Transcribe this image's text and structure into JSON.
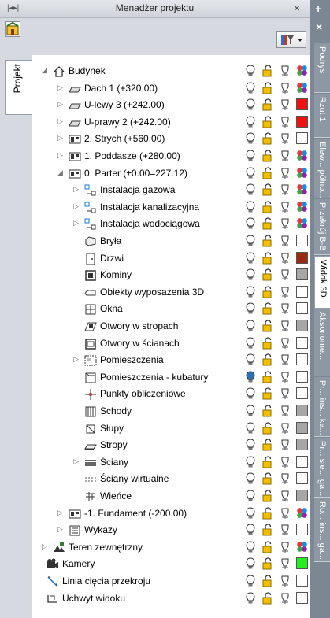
{
  "panel": {
    "title": "Menadżer projektu",
    "grip_icon": "grip-icon",
    "close_glyph": "×"
  },
  "left_tab": {
    "label": "Projekt"
  },
  "right_tabs": {
    "plus_glyph": "+",
    "close_glyph": "×",
    "items": [
      {
        "label": "Podrys"
      },
      {
        "label": "Rzut 1"
      },
      {
        "label": "Elew... półno..."
      },
      {
        "label": "Przekrój B-B"
      },
      {
        "label": "Widok 3D",
        "active": true
      },
      {
        "label": "Aksonome..."
      },
      {
        "label": "Pr... ins... ka..."
      },
      {
        "label": "Pr... sie... ga..."
      },
      {
        "label": "Ro... ins... ga..."
      }
    ]
  },
  "colors": {
    "red": "#ee1111",
    "dark_red": "#9b2a11",
    "gray": "#a6a6a6",
    "green": "#22ee22",
    "white": "#ffffff"
  },
  "tree": [
    {
      "label": "Budynek",
      "icon": "house-icon",
      "level": 0,
      "expander": "open",
      "color": "multi"
    },
    {
      "label": "Dach 1 (+320.00)",
      "icon": "roof-icon",
      "level": 1,
      "expander": "closed",
      "color": "multi"
    },
    {
      "label": "U-lewy 3 (+242.00)",
      "icon": "roof-icon",
      "level": 1,
      "expander": "closed",
      "color": "red"
    },
    {
      "label": "U-prawy 2 (+242.00)",
      "icon": "roof-icon",
      "level": 1,
      "expander": "closed",
      "color": "red"
    },
    {
      "label": "2. Strych (+560.00)",
      "icon": "storey-icon",
      "level": 1,
      "expander": "closed",
      "color": "white"
    },
    {
      "label": "1. Poddasze (+280.00)",
      "icon": "storey-icon",
      "level": 1,
      "expander": "closed",
      "color": "multi"
    },
    {
      "label": "0. Parter (±0.00=227.12)",
      "icon": "storey-icon",
      "level": 1,
      "expander": "open",
      "color": "multi"
    },
    {
      "label": "Instalacja gazowa",
      "icon": "installation-icon",
      "level": 2,
      "expander": "closed",
      "color": "multi"
    },
    {
      "label": "Instalacja kanalizacyjna",
      "icon": "installation-icon",
      "level": 2,
      "expander": "closed",
      "color": "multi"
    },
    {
      "label": "Instalacja wodociągowa",
      "icon": "installation-icon",
      "level": 2,
      "expander": "closed",
      "color": "multi"
    },
    {
      "label": "Bryła",
      "icon": "solid-icon",
      "level": 2,
      "expander": "none",
      "color": "white"
    },
    {
      "label": "Drzwi",
      "icon": "door-icon",
      "level": 2,
      "expander": "none",
      "color": "dark_red"
    },
    {
      "label": "Kominy",
      "icon": "chimney-icon",
      "level": 2,
      "expander": "none",
      "color": "gray"
    },
    {
      "label": "Obiekty wyposażenia 3D",
      "icon": "furniture-icon",
      "level": 2,
      "expander": "none",
      "color": "white"
    },
    {
      "label": "Okna",
      "icon": "window-icon",
      "level": 2,
      "expander": "none",
      "color": "white"
    },
    {
      "label": "Otwory w stropach",
      "icon": "ceiling-opening-icon",
      "level": 2,
      "expander": "none",
      "color": "gray"
    },
    {
      "label": "Otwory w ścianach",
      "icon": "wall-opening-icon",
      "level": 2,
      "expander": "none",
      "color": "white"
    },
    {
      "label": "Pomieszczenia",
      "icon": "room-icon",
      "level": 2,
      "expander": "closed",
      "color": "white"
    },
    {
      "label": "Pomieszczenia - kubatury",
      "icon": "room-volume-icon",
      "level": 2,
      "expander": "none",
      "color": "white",
      "bulb": "blue"
    },
    {
      "label": "Punkty obliczeniowe",
      "icon": "calc-point-icon",
      "level": 2,
      "expander": "none",
      "color": "white"
    },
    {
      "label": "Schody",
      "icon": "stairs-icon",
      "level": 2,
      "expander": "none",
      "color": "gray"
    },
    {
      "label": "Słupy",
      "icon": "column-icon",
      "level": 2,
      "expander": "none",
      "color": "gray"
    },
    {
      "label": "Stropy",
      "icon": "slab-icon",
      "level": 2,
      "expander": "none",
      "color": "gray"
    },
    {
      "label": "Ściany",
      "icon": "wall-icon",
      "level": 2,
      "expander": "closed",
      "color": "white"
    },
    {
      "label": "Ściany wirtualne",
      "icon": "virtual-wall-icon",
      "level": 2,
      "expander": "none",
      "color": "white"
    },
    {
      "label": "Wieńce",
      "icon": "ring-beam-icon",
      "level": 2,
      "expander": "none",
      "color": "gray"
    },
    {
      "label": "-1. Fundament (-200.00)",
      "icon": "storey-icon",
      "level": 1,
      "expander": "closed",
      "color": "multi"
    },
    {
      "label": "Wykazy",
      "icon": "list-icon",
      "level": 1,
      "expander": "closed",
      "color": "white"
    },
    {
      "label": "Teren zewnętrzny",
      "icon": "terrain-icon",
      "level": 0,
      "expander": "closed",
      "color": "multi"
    },
    {
      "label": "Kamery",
      "icon": "camera-icon",
      "level": -1,
      "expander": "none",
      "color": "green"
    },
    {
      "label": "Linia cięcia przekroju",
      "icon": "section-line-icon",
      "level": -1,
      "expander": "none",
      "color": "white"
    },
    {
      "label": "Uchwyt widoku",
      "icon": "view-handle-icon",
      "level": -1,
      "expander": "none",
      "color": "white"
    }
  ]
}
